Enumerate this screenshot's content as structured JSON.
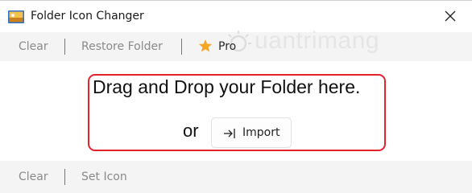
{
  "window": {
    "title": "Folder Icon Changer",
    "close_icon": "close-icon",
    "app_icon": "folder-picture-icon"
  },
  "toolbar": {
    "clear_label": "Clear",
    "restore_label": "Restore Folder",
    "pro_label": "Pro",
    "pro_icon": "star-icon",
    "star_color": "#f5a623"
  },
  "watermark": {
    "text": "uantrimang"
  },
  "drop_zone": {
    "message": "Drag and Drop your Folder here.",
    "or_label": "or",
    "import_label": "Import",
    "import_icon": "import-arrow-icon",
    "highlight_color": "#e3232c"
  },
  "bottom_bar": {
    "clear_label": "Clear",
    "set_icon_label": "Set Icon"
  }
}
